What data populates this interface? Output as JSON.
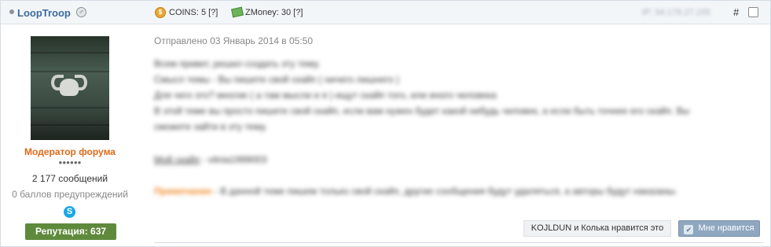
{
  "header": {
    "author": "LoopTroop",
    "gender_icon": "male-symbol",
    "coins": "COINS: 5 [?]",
    "zmoney": "ZMoney: 30 [?]",
    "ip": "IP: 94.178.27.155",
    "permalink": "#"
  },
  "author_pane": {
    "group_title": "Модератор форума",
    "rank_pips": "●●●●●●",
    "post_count": "2 177 сообщений",
    "warn_points": "0 баллов предупреждений",
    "reputation": "Репутация: 637"
  },
  "post": {
    "date": "Отправлено 03 Январь 2014 в 05:50",
    "lines": [
      "Всем привет, решил создать эту тему.",
      "Смысл темы - Вы пишете свой скайп ( ничего лишнего )",
      "Для чего это? многие ( а там мысли и я ) ищут скайп того, или иного человека",
      "В этой теме вы просто пишете свой скайп, если вам нужен будет какой нибудь человек, а если быть точнее его скайп. Вы",
      "сможете зайти в эту тему."
    ],
    "mod_label": "Мой скайп",
    "mod_value": " - vitnia1999003",
    "note_label": "Примечание",
    "note_text": " - В данной теме пишем только свой скайп, другие сообщения будут удаляться, а авторы будут наказаны."
  },
  "footer": {
    "likes_text": "KOJLDUN и Колька нравится это",
    "like_button": "Мне нравится"
  },
  "colors": {
    "author": "#3d6a9d",
    "group_title": "#e06a18",
    "reputation_bg": "#5f8a3c",
    "note_label": "#f08a2c",
    "like_button_bg": "#8fa7bf"
  }
}
